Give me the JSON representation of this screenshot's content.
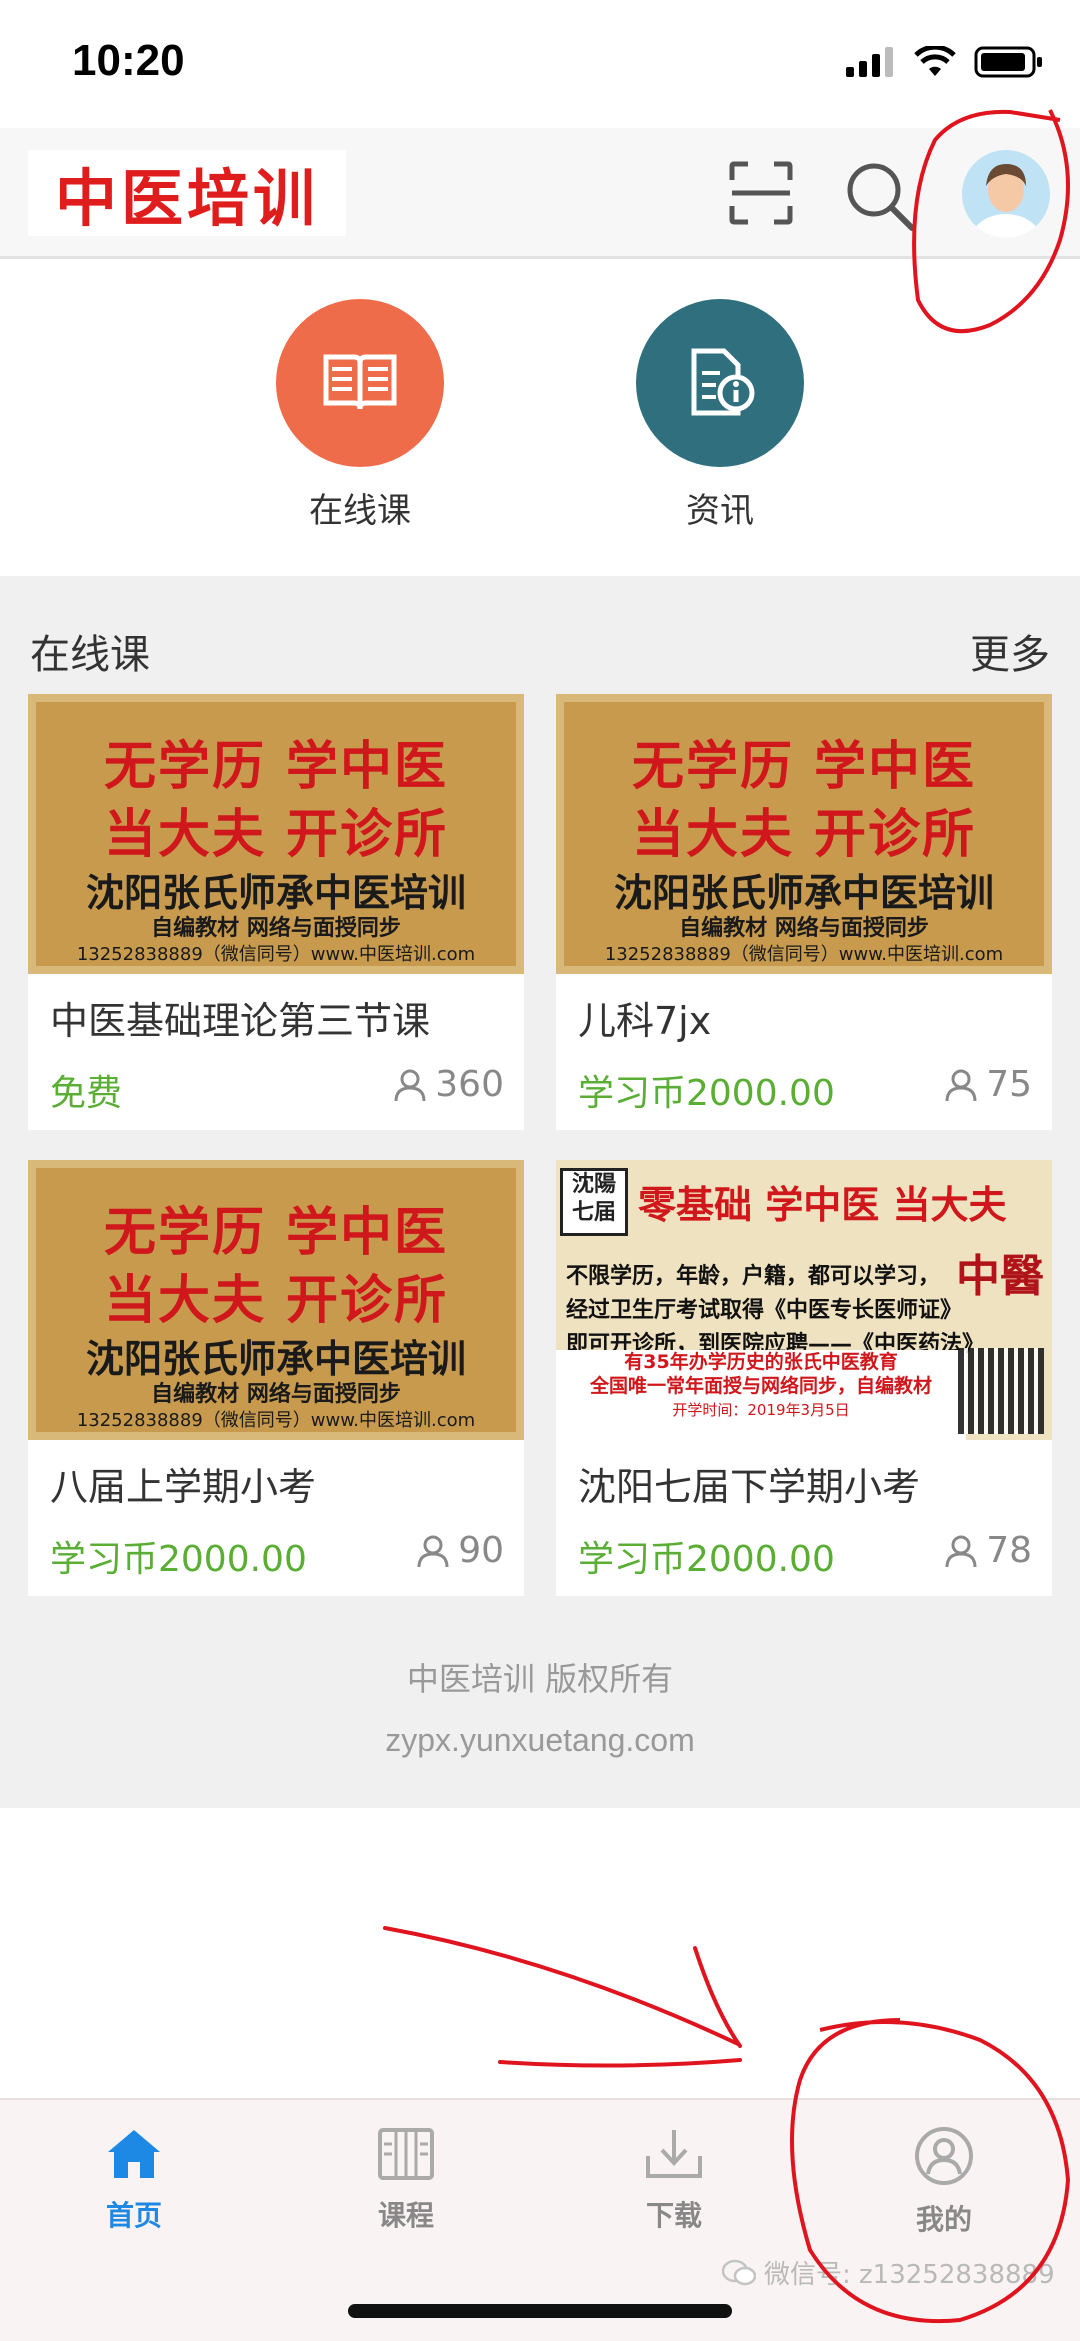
{
  "status_bar": {
    "time": "10:20"
  },
  "header": {
    "logo_text": "中医培训",
    "icons": [
      "scan-icon",
      "search-icon",
      "avatar"
    ]
  },
  "quick_links": [
    {
      "label": "在线课",
      "icon": "book-icon",
      "color": "#ef6c4a"
    },
    {
      "label": "资讯",
      "icon": "info-document-icon",
      "color": "#2f6f7e"
    }
  ],
  "courses_section": {
    "title": "在线课",
    "more": "更多",
    "banner_a": {
      "line1": "无学历  学中医",
      "line2": "当大夫  开诊所",
      "line3": "沈阳张氏师承中医培训",
      "line4": "自编教材    网络与面授同步",
      "line5": "13252838889（微信同号）www.中医培训.com"
    },
    "banner_b": {
      "seal": "沈陽七届",
      "headline": "零基础 学中医 当大夫",
      "body1": "不限学历，年龄，户籍，都可以学习，",
      "body2": "经过卫生厅考试取得《中医专长医师证》",
      "body3": "即可开诊所，到医院应聘——《中医药法》",
      "box1": "有35年办学历史的张氏中医教育",
      "box2": "全国唯一常年面授与网络同步，自编教材",
      "box3": "开学时间：2019年3月5日",
      "side": "中醫"
    },
    "items": [
      {
        "title": "中医基础理论第三节课",
        "price": "免费",
        "students": "360"
      },
      {
        "title": "儿科7jx",
        "price": "学习币2000.00",
        "students": "75"
      },
      {
        "title": "八届上学期小考",
        "price": "学习币2000.00",
        "students": "90"
      },
      {
        "title": "沈阳七届下学期小考",
        "price": "学习币2000.00",
        "students": "78"
      }
    ]
  },
  "footer": {
    "copyright": "中医培训 版权所有",
    "url": "zypx.yunxuetang.com"
  },
  "tabbar": {
    "tabs": [
      {
        "label": "首页",
        "icon": "home-icon",
        "active": true
      },
      {
        "label": "课程",
        "icon": "courses-icon",
        "active": false
      },
      {
        "label": "下载",
        "icon": "download-icon",
        "active": false
      },
      {
        "label": "我的",
        "icon": "user-icon",
        "active": false
      }
    ]
  },
  "watermark": "微信号: z13252838889",
  "colors": {
    "accent_blue": "#1e88e5",
    "price_green": "#5aae34",
    "logo_red": "#e01d1d",
    "annotation_red": "#e0141e"
  }
}
